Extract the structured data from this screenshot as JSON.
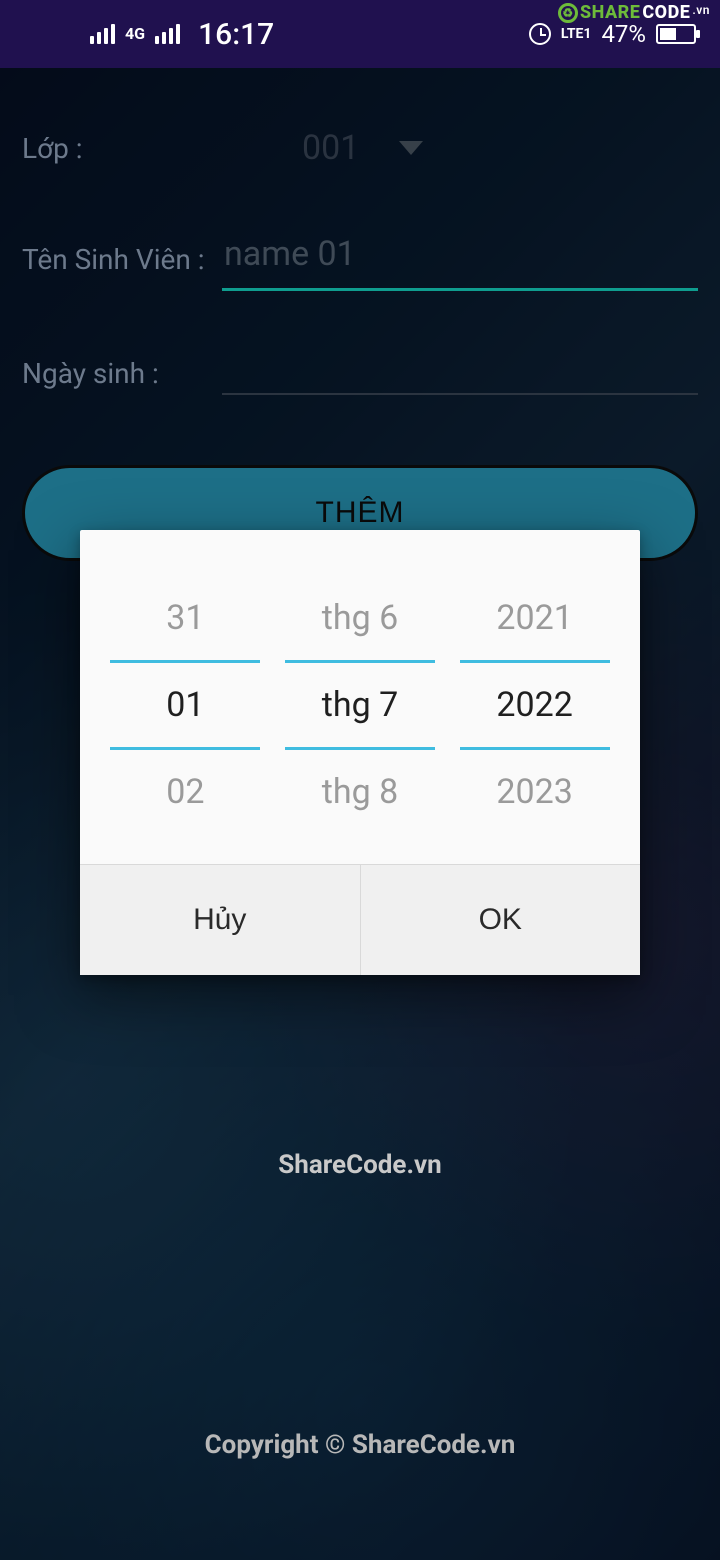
{
  "status": {
    "time": "16:17",
    "network_type": "4G",
    "lte_label": "LTE1",
    "battery_pct": "47%"
  },
  "watermark_brand": {
    "share": "SHARE",
    "code": "CODE",
    "vn": ".vn"
  },
  "form": {
    "class_label": "Lớp :",
    "class_value": "001",
    "name_label": "Tên Sinh Viên :",
    "name_value": "name 01",
    "dob_label": "Ngày sinh :",
    "add_label": "THÊM"
  },
  "date_picker": {
    "day": {
      "prev": "31",
      "sel": "01",
      "next": "02"
    },
    "month": {
      "prev": "thg 6",
      "sel": "thg 7",
      "next": "thg 8"
    },
    "year": {
      "prev": "2021",
      "sel": "2022",
      "next": "2023"
    },
    "cancel": "Hủy",
    "ok": "OK"
  },
  "watermark_center": "ShareCode.vn",
  "footer": "Copyright © ShareCode.vn"
}
